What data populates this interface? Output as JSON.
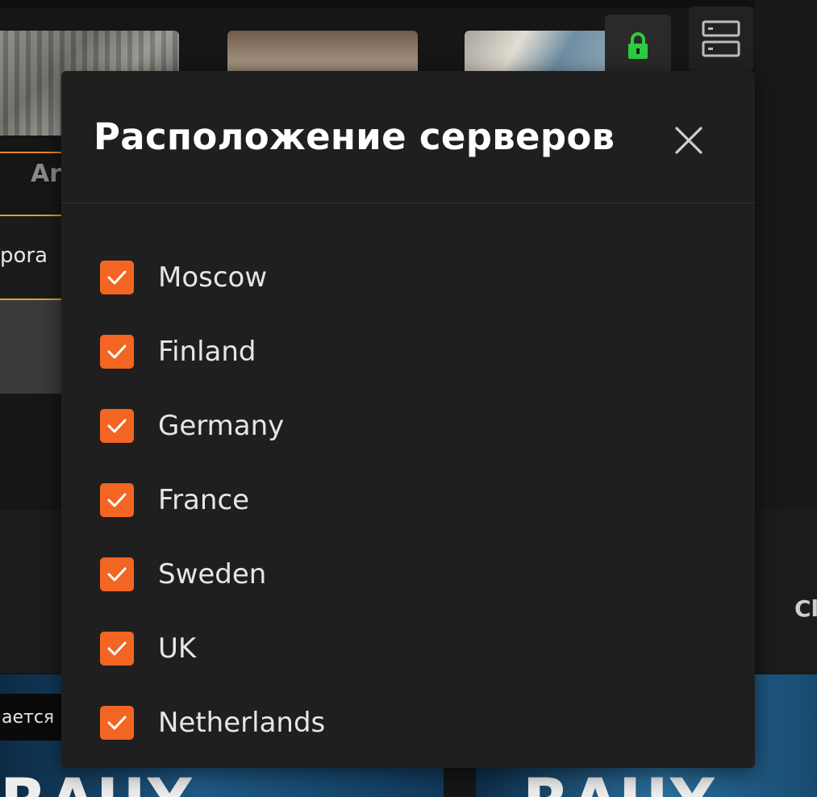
{
  "background": {
    "tab_label_fragment": "Ar",
    "field_text_fragment": "pora",
    "right_text_fragment": "Cl",
    "banner_tag_fragment": "ается",
    "banner_big_left": "RAUY",
    "banner_big_right": "RAUY"
  },
  "toolbar": {
    "lock_icon": "lock-icon",
    "lock_color": "#2ecc40",
    "server_icon": "server-icon"
  },
  "modal": {
    "title": "Расположение серверов",
    "close_icon": "close-icon",
    "accent_color": "#f26522",
    "options": [
      {
        "label": "Moscow",
        "checked": true
      },
      {
        "label": "Finland",
        "checked": true
      },
      {
        "label": "Germany",
        "checked": true
      },
      {
        "label": "France",
        "checked": true
      },
      {
        "label": "Sweden",
        "checked": true
      },
      {
        "label": "UK",
        "checked": true
      },
      {
        "label": "Netherlands",
        "checked": true
      }
    ]
  }
}
